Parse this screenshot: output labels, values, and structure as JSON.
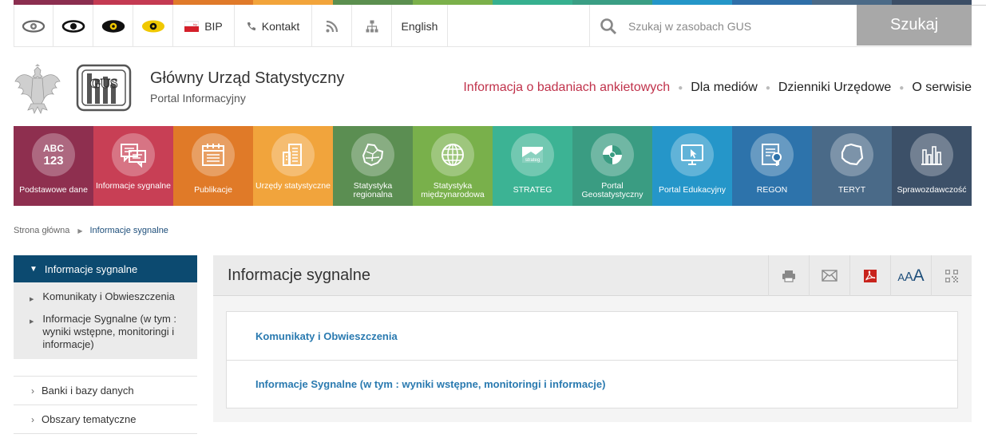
{
  "colors": {
    "stripe": [
      "#8b2e4f",
      "#c43a52",
      "#e07a2a",
      "#f2a43b",
      "#5b8f4f",
      "#7bb04a",
      "#36b08f",
      "#3a9e84",
      "#2496c8",
      "#2f6fa8",
      "#4b6a87",
      "#3c4e66"
    ],
    "accent_link": "#2a7ab0",
    "highlight_nav": "#c0324b",
    "sidebar_active": "#0c4a70",
    "search_button": "#a8a8a8"
  },
  "topbar": {
    "eyes": [
      {
        "name": "contrast-default-icon",
        "pupil": "#777777"
      },
      {
        "name": "contrast-black-icon",
        "pupil": "#111111"
      },
      {
        "name": "contrast-black-yellow-icon",
        "pupil": "#111111"
      },
      {
        "name": "contrast-yellow-icon",
        "pupil": "#f0c800"
      }
    ],
    "bip_label": "BIP",
    "contact_label": "Kontakt",
    "english_label": "English",
    "search_placeholder": "Szukaj w zasobach GUS",
    "search_button": "Szukaj"
  },
  "header": {
    "title": "Główny Urząd Statystyczny",
    "subtitle": "Portal Informacyjny",
    "nav": [
      "Informacja o badaniach ankietowych",
      "Dla mediów",
      "Dzienniki Urzędowe",
      "O serwisie"
    ]
  },
  "tiles": [
    {
      "label": "Podstawowe dane",
      "color": "#8e2f4f",
      "icon": "abc-123-icon"
    },
    {
      "label": "Informacje sygnalne",
      "color": "#c83f55",
      "icon": "chat-icon"
    },
    {
      "label": "Publikacje",
      "color": "#e07a28",
      "icon": "calendar-icon"
    },
    {
      "label": "Urzędy statystyczne",
      "color": "#f1a43c",
      "icon": "buildings-icon"
    },
    {
      "label": "Statystyka regionalna",
      "color": "#5b8e52",
      "icon": "regions-map-icon"
    },
    {
      "label": "Statystyka międzynarodowa",
      "color": "#79b04b",
      "icon": "globe-icon"
    },
    {
      "label": "STRATEG",
      "color": "#3cb394",
      "icon": "strateg-icon"
    },
    {
      "label": "Portal Geostatystyczny",
      "color": "#3a9c82",
      "icon": "geo-portal-icon"
    },
    {
      "label": "Portal Edukacyjny",
      "color": "#2596c9",
      "icon": "monitor-pointer-icon"
    },
    {
      "label": "REGON",
      "color": "#2d73ab",
      "icon": "document-search-icon"
    },
    {
      "label": "TERYT",
      "color": "#4a6a88",
      "icon": "poland-map-icon"
    },
    {
      "label": "Sprawozdawczość",
      "color": "#3c5068",
      "icon": "bar-chart-icon"
    }
  ],
  "breadcrumb": {
    "home": "Strona główna",
    "current": "Informacje sygnalne"
  },
  "sidebar": {
    "active": "Informacje sygnalne",
    "sub_items": [
      "Komunikaty i Obwieszczenia",
      "Informacje Sygnalne (w tym : wyniki wstępne, monitoringi i informacje)"
    ],
    "items": [
      "Banki i bazy danych",
      "Obszary tematyczne"
    ]
  },
  "main": {
    "title": "Informacje sygnalne",
    "list": [
      "Komunikaty i Obwieszczenia",
      "Informacje Sygnalne (w tym : wyniki wstępne, monitoringi i informacje)"
    ],
    "font_size_letters": [
      "A",
      "A",
      "A"
    ]
  }
}
